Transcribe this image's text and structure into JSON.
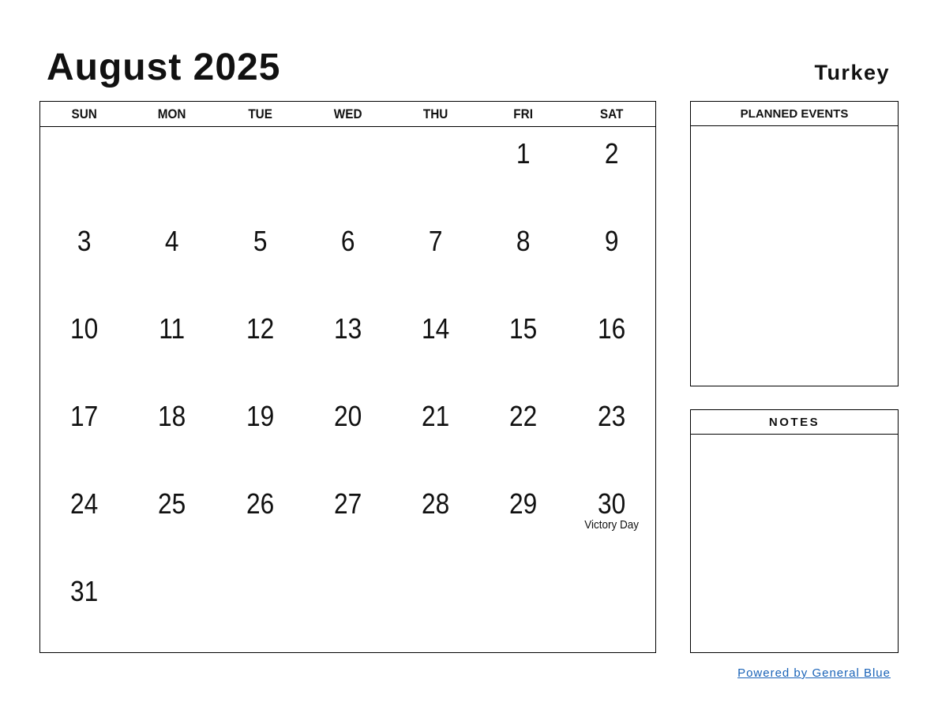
{
  "header": {
    "title": "August 2025",
    "country": "Turkey"
  },
  "calendar": {
    "weekdays": [
      "SUN",
      "MON",
      "TUE",
      "WED",
      "THU",
      "FRI",
      "SAT"
    ],
    "weeks": [
      [
        {
          "day": ""
        },
        {
          "day": ""
        },
        {
          "day": ""
        },
        {
          "day": ""
        },
        {
          "day": ""
        },
        {
          "day": "1"
        },
        {
          "day": "2"
        }
      ],
      [
        {
          "day": "3"
        },
        {
          "day": "4"
        },
        {
          "day": "5"
        },
        {
          "day": "6"
        },
        {
          "day": "7"
        },
        {
          "day": "8"
        },
        {
          "day": "9"
        }
      ],
      [
        {
          "day": "10"
        },
        {
          "day": "11"
        },
        {
          "day": "12"
        },
        {
          "day": "13"
        },
        {
          "day": "14"
        },
        {
          "day": "15"
        },
        {
          "day": "16"
        }
      ],
      [
        {
          "day": "17"
        },
        {
          "day": "18"
        },
        {
          "day": "19"
        },
        {
          "day": "20"
        },
        {
          "day": "21"
        },
        {
          "day": "22"
        },
        {
          "day": "23"
        }
      ],
      [
        {
          "day": "24"
        },
        {
          "day": "25"
        },
        {
          "day": "26"
        },
        {
          "day": "27"
        },
        {
          "day": "28"
        },
        {
          "day": "29"
        },
        {
          "day": "30",
          "holiday": "Victory Day"
        }
      ],
      [
        {
          "day": "31"
        },
        {
          "day": ""
        },
        {
          "day": ""
        },
        {
          "day": ""
        },
        {
          "day": ""
        },
        {
          "day": ""
        },
        {
          "day": ""
        }
      ]
    ]
  },
  "panels": {
    "planned_events": "PLANNED EVENTS",
    "notes": "NOTES"
  },
  "footer": {
    "powered_by": "Powered by General Blue",
    "link_color": "#1a63b8"
  }
}
